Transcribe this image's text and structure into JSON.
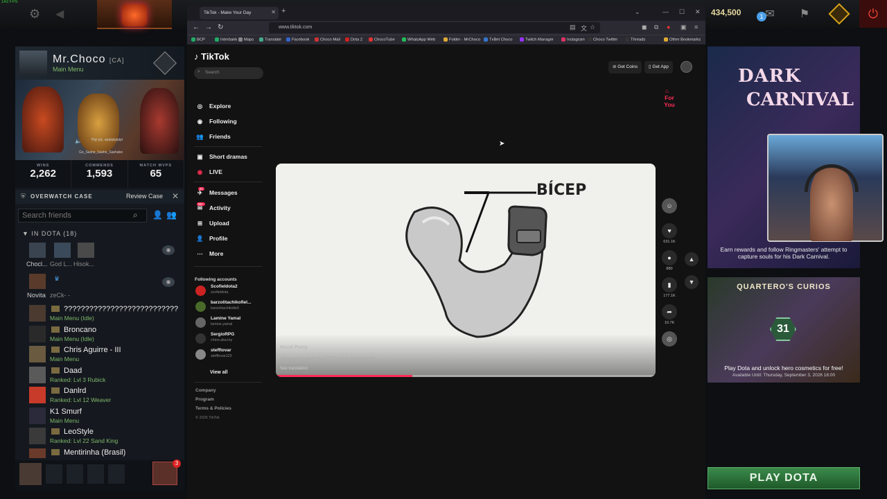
{
  "dota": {
    "fps": "143 FPS",
    "gold": "434,500",
    "notif_count": "1",
    "profile": {
      "name": "Mr.Choco",
      "tag": "[CA]",
      "status": "Main Menu"
    },
    "hero_caption": "Pipi pic, apipipipipipi",
    "hero_caption2": "Go_Sashe_Sashe_Sashabe",
    "stats": [
      {
        "label": "WINS",
        "value": "2,262"
      },
      {
        "label": "COMMENDS",
        "value": "1,593"
      },
      {
        "label": "MATCH MVPS",
        "value": "65"
      }
    ],
    "overwatch": {
      "label": "OVERWATCH CASE",
      "review": "Review Case"
    },
    "search_placeholder": "Search friends",
    "in_dota": "IN DOTA (18)",
    "party1": [
      "Chocl...",
      "God L...",
      "Hisok..."
    ],
    "party2": [
      "Novita",
      "zeCk-  -"
    ],
    "friends": [
      {
        "name": "???????????????????????????",
        "status": "Main Menu (Idle)"
      },
      {
        "name": "Broncano",
        "status": "Main Menu (Idle)"
      },
      {
        "name": "Chris Aguirre - III",
        "status": "Main Menu"
      },
      {
        "name": "Daad",
        "status": "Ranked: Lvl 3 Rubick"
      },
      {
        "name": "Danlrd",
        "status": "Ranked: Lvl 12 Weaver"
      },
      {
        "name": "K1 Smurf",
        "status": "Main Menu"
      },
      {
        "name": "LeoStyle",
        "status": "Ranked: Lvl 22 Sand King"
      },
      {
        "name": "Mentirinha (Brasil)",
        "status": ""
      }
    ],
    "chat_badge": "3",
    "dark_carnival": {
      "line1": "DARK",
      "line2": "CARNIVAL",
      "desc": "Earn rewards and follow Ringmasters' attempt to capture souls for his Dark Carnival."
    },
    "curios": {
      "title": "QUARTERO'S CURIOS",
      "badge": "31",
      "desc": "Play Dota and unlock hero cosmetics for free!",
      "until": "Available Until: Thursday, September 3, 2026 18:00"
    },
    "play": "PLAY DOTA"
  },
  "browser": {
    "tab_title": "TikTok - Make Your Day",
    "url": "www.tiktok.com",
    "bookmarks": [
      "BCP",
      "Interbank",
      "Maps",
      "Translate",
      "Facebook",
      "Choco Mail",
      "Dota 2",
      "ChocoTube",
      "WhatsApp Web",
      "Folder - MrChoco",
      "TxBet Choco",
      "Twitch Manager",
      "Instagram",
      "Choco Twitter",
      "Threads",
      "Other Bookmarks"
    ]
  },
  "tiktok": {
    "logo": "TikTok",
    "search_placeholder": "Search",
    "nav": [
      "For You",
      "Explore",
      "Following",
      "Friends",
      "Short dramas",
      "LIVE",
      "Messages",
      "Activity",
      "Upload",
      "Profile",
      "More"
    ],
    "messages_badge": "21",
    "activity_badge": "99+",
    "following_header": "Following accounts",
    "accounts": [
      {
        "name": "Scofieldota2",
        "user": "scofieldota"
      },
      {
        "name": "barzolitachikofiel...",
        "user": "barzolitachikofie5"
      },
      {
        "name": "Lamine Yamal",
        "user": "lamine.yamal"
      },
      {
        "name": "SergioRPG",
        "user": "chino.aka.toy"
      },
      {
        "name": "stefftovar",
        "user": "stefftovar123"
      }
    ],
    "view_all": "View all",
    "footer": [
      "Company",
      "Program",
      "Terms & Policies",
      "© 2026 TikTok"
    ],
    "get_coins": "Get Coins",
    "get_app": "Get App",
    "video": {
      "label": "BÍCEP",
      "author": "Mural Pump",
      "caption": "¿Brazos delgados? Haz ESTO con la calistenia #01",
      "see_translation": "See translation",
      "progress": 0.36
    },
    "actions": {
      "likes": "631.1K",
      "comments": "880",
      "saves": "177.1K",
      "shares": "10.7K"
    }
  },
  "colors": {
    "accent": "#fe2c55",
    "play": "#3a8a4a"
  }
}
